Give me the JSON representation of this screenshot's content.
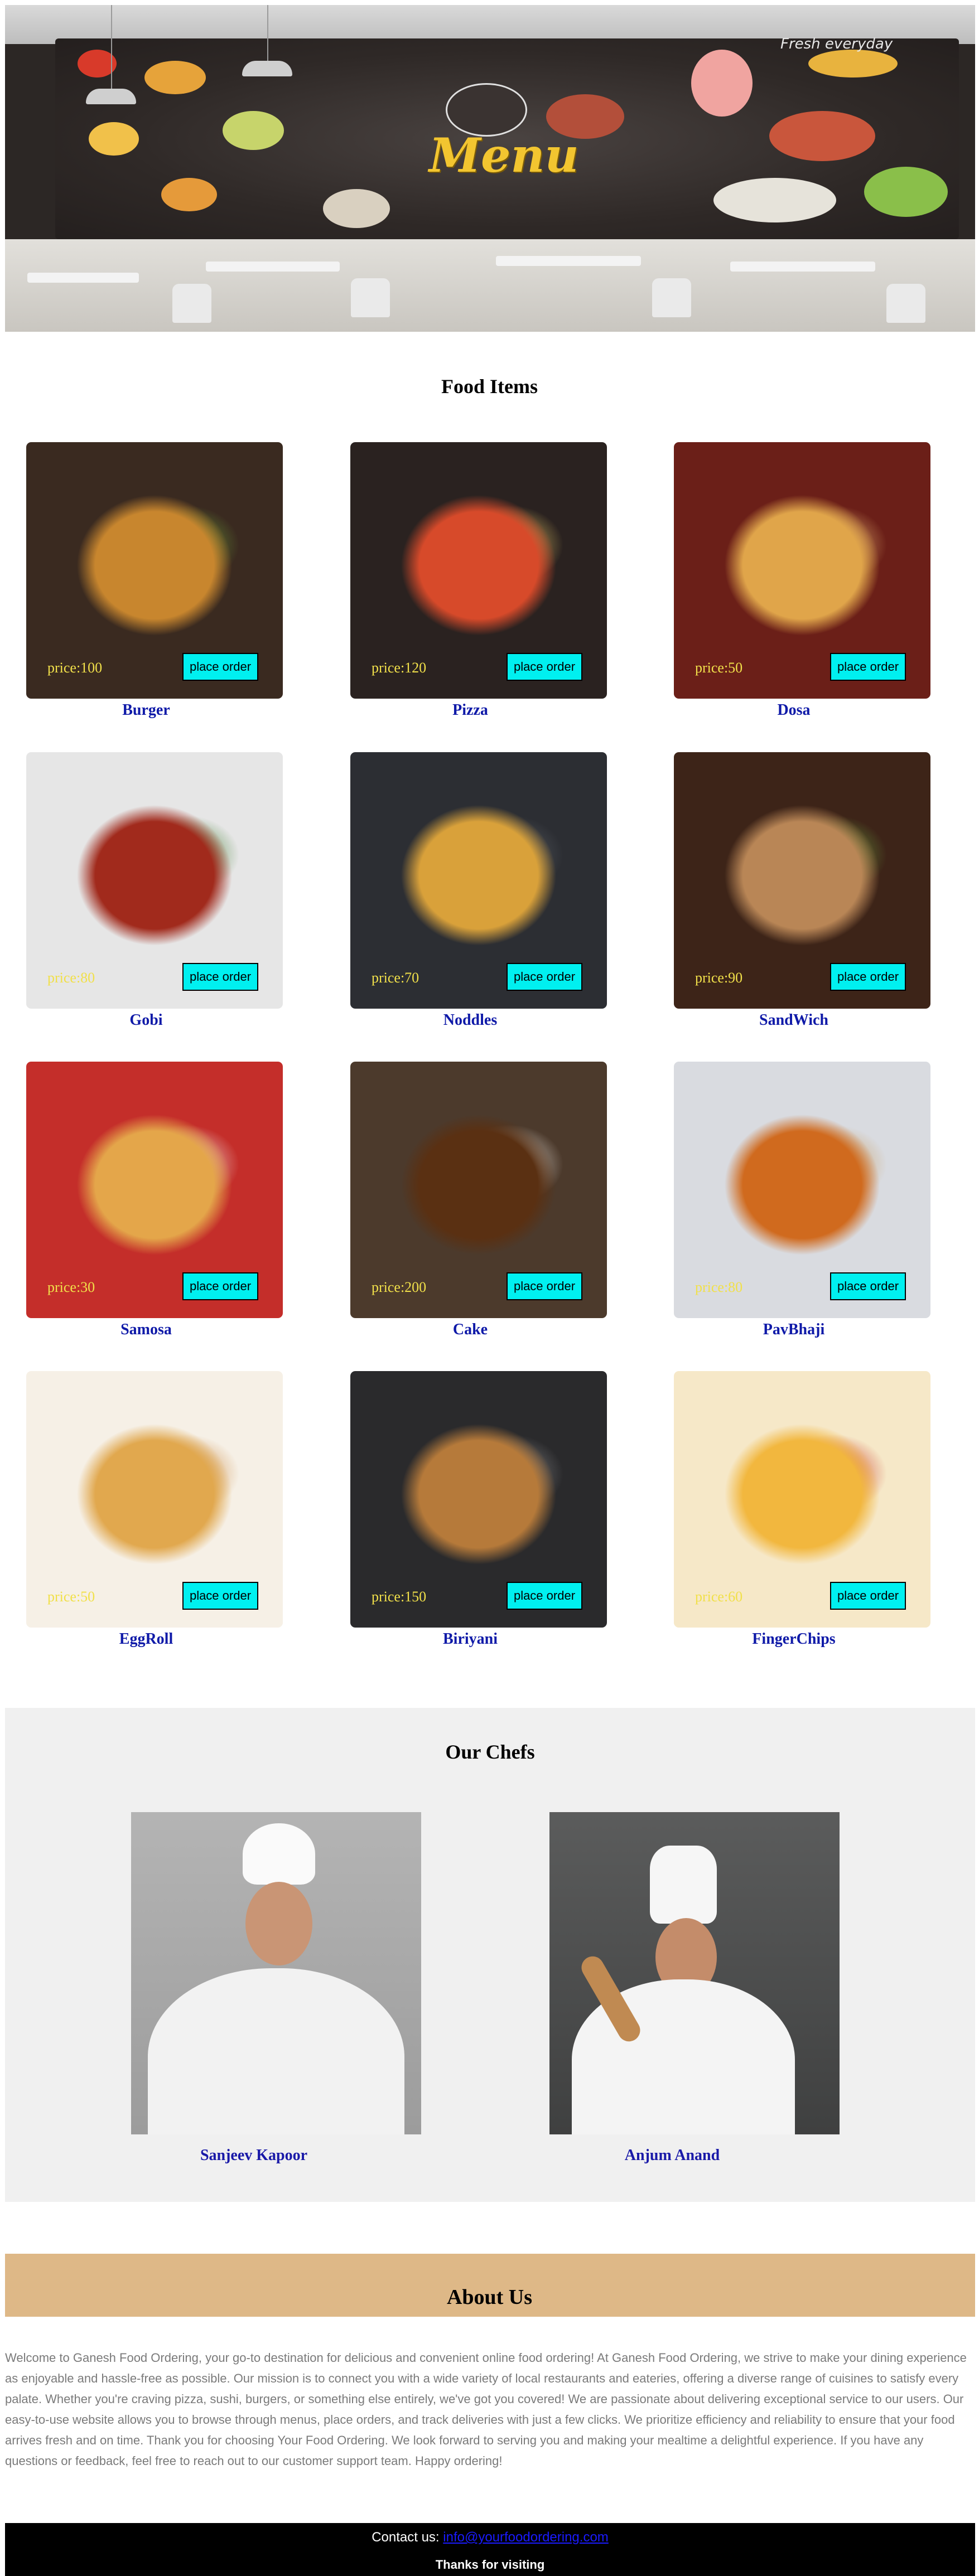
{
  "hero": {
    "menu_word": "Menu",
    "fresh_text": "Fresh   everyday"
  },
  "food_section": {
    "title": "Food Items",
    "button_label": "place order",
    "items": [
      {
        "name": "Burger",
        "price": "price:100",
        "colors": [
          "#3a2a20",
          "#c8862e",
          "#6fa43a"
        ]
      },
      {
        "name": "Pizza",
        "price": "price:120",
        "colors": [
          "#2a2220",
          "#d74a2a",
          "#f1d26a"
        ]
      },
      {
        "name": "Dosa",
        "price": "price:50",
        "colors": [
          "#6b1f18",
          "#e0a54a",
          "#f0c37a"
        ]
      },
      {
        "name": "Gobi",
        "price": "price:80",
        "colors": [
          "#e6e6e6",
          "#a12a1c",
          "#3a7a2a"
        ]
      },
      {
        "name": "Noddles",
        "price": "price:70",
        "colors": [
          "#2c2e33",
          "#d9a13a",
          "#5a5f66"
        ]
      },
      {
        "name": "SandWich",
        "price": "price:90",
        "colors": [
          "#3d2418",
          "#b98656",
          "#6ba241"
        ]
      },
      {
        "name": "Samosa",
        "price": "price:30",
        "colors": [
          "#c42e2a",
          "#e4a64a",
          "#f1f1ea"
        ]
      },
      {
        "name": "Cake",
        "price": "price:200",
        "colors": [
          "#4c3a2c",
          "#5a3012",
          "#efe8df"
        ]
      },
      {
        "name": "PavBhaji",
        "price": "price:80",
        "colors": [
          "#d9dbe0",
          "#d06a1e",
          "#c89a5a"
        ]
      },
      {
        "name": "EggRoll",
        "price": "price:50",
        "colors": [
          "#f6f0e6",
          "#e1a84e",
          "#c9853a"
        ]
      },
      {
        "name": "Biriyani",
        "price": "price:150",
        "colors": [
          "#2a2a2c",
          "#b67a3a",
          "#8a8a8c"
        ]
      },
      {
        "name": "FingerChips",
        "price": "price:60",
        "colors": [
          "#f6e8c8",
          "#f2b73e",
          "#c62a1c"
        ]
      }
    ]
  },
  "chefs_section": {
    "title": "Our Chefs",
    "chefs": [
      {
        "name": "Sanjeev Kapoor"
      },
      {
        "name": "Anjum Anand"
      }
    ]
  },
  "about_section": {
    "title": "About Us",
    "text": "Welcome to Ganesh Food Ordering, your go-to destination for delicious and convenient online food ordering! At Ganesh Food Ordering, we strive to make your dining experience as enjoyable and hassle-free as possible. Our mission is to connect you with a wide variety of local restaurants and eateries, offering a diverse range of cuisines to satisfy every palate. Whether you're craving pizza, sushi, burgers, or something else entirely, we've got you covered! We are passionate about delivering exceptional service to our users. Our easy-to-use website allows you to browse through menus, place orders, and track deliveries with just a few clicks. We prioritize efficiency and reliability to ensure that your food arrives fresh and on time. Thank you for choosing Your Food Ordering. We look forward to serving you and making your mealtime a delightful experience. If you have any questions or feedback, feel free to reach out to our customer support team. Happy ordering!"
  },
  "footer": {
    "contact_prefix": "Contact us: ",
    "email": "info@yourfoodordering.com",
    "thanks": "Thanks for visiting"
  }
}
